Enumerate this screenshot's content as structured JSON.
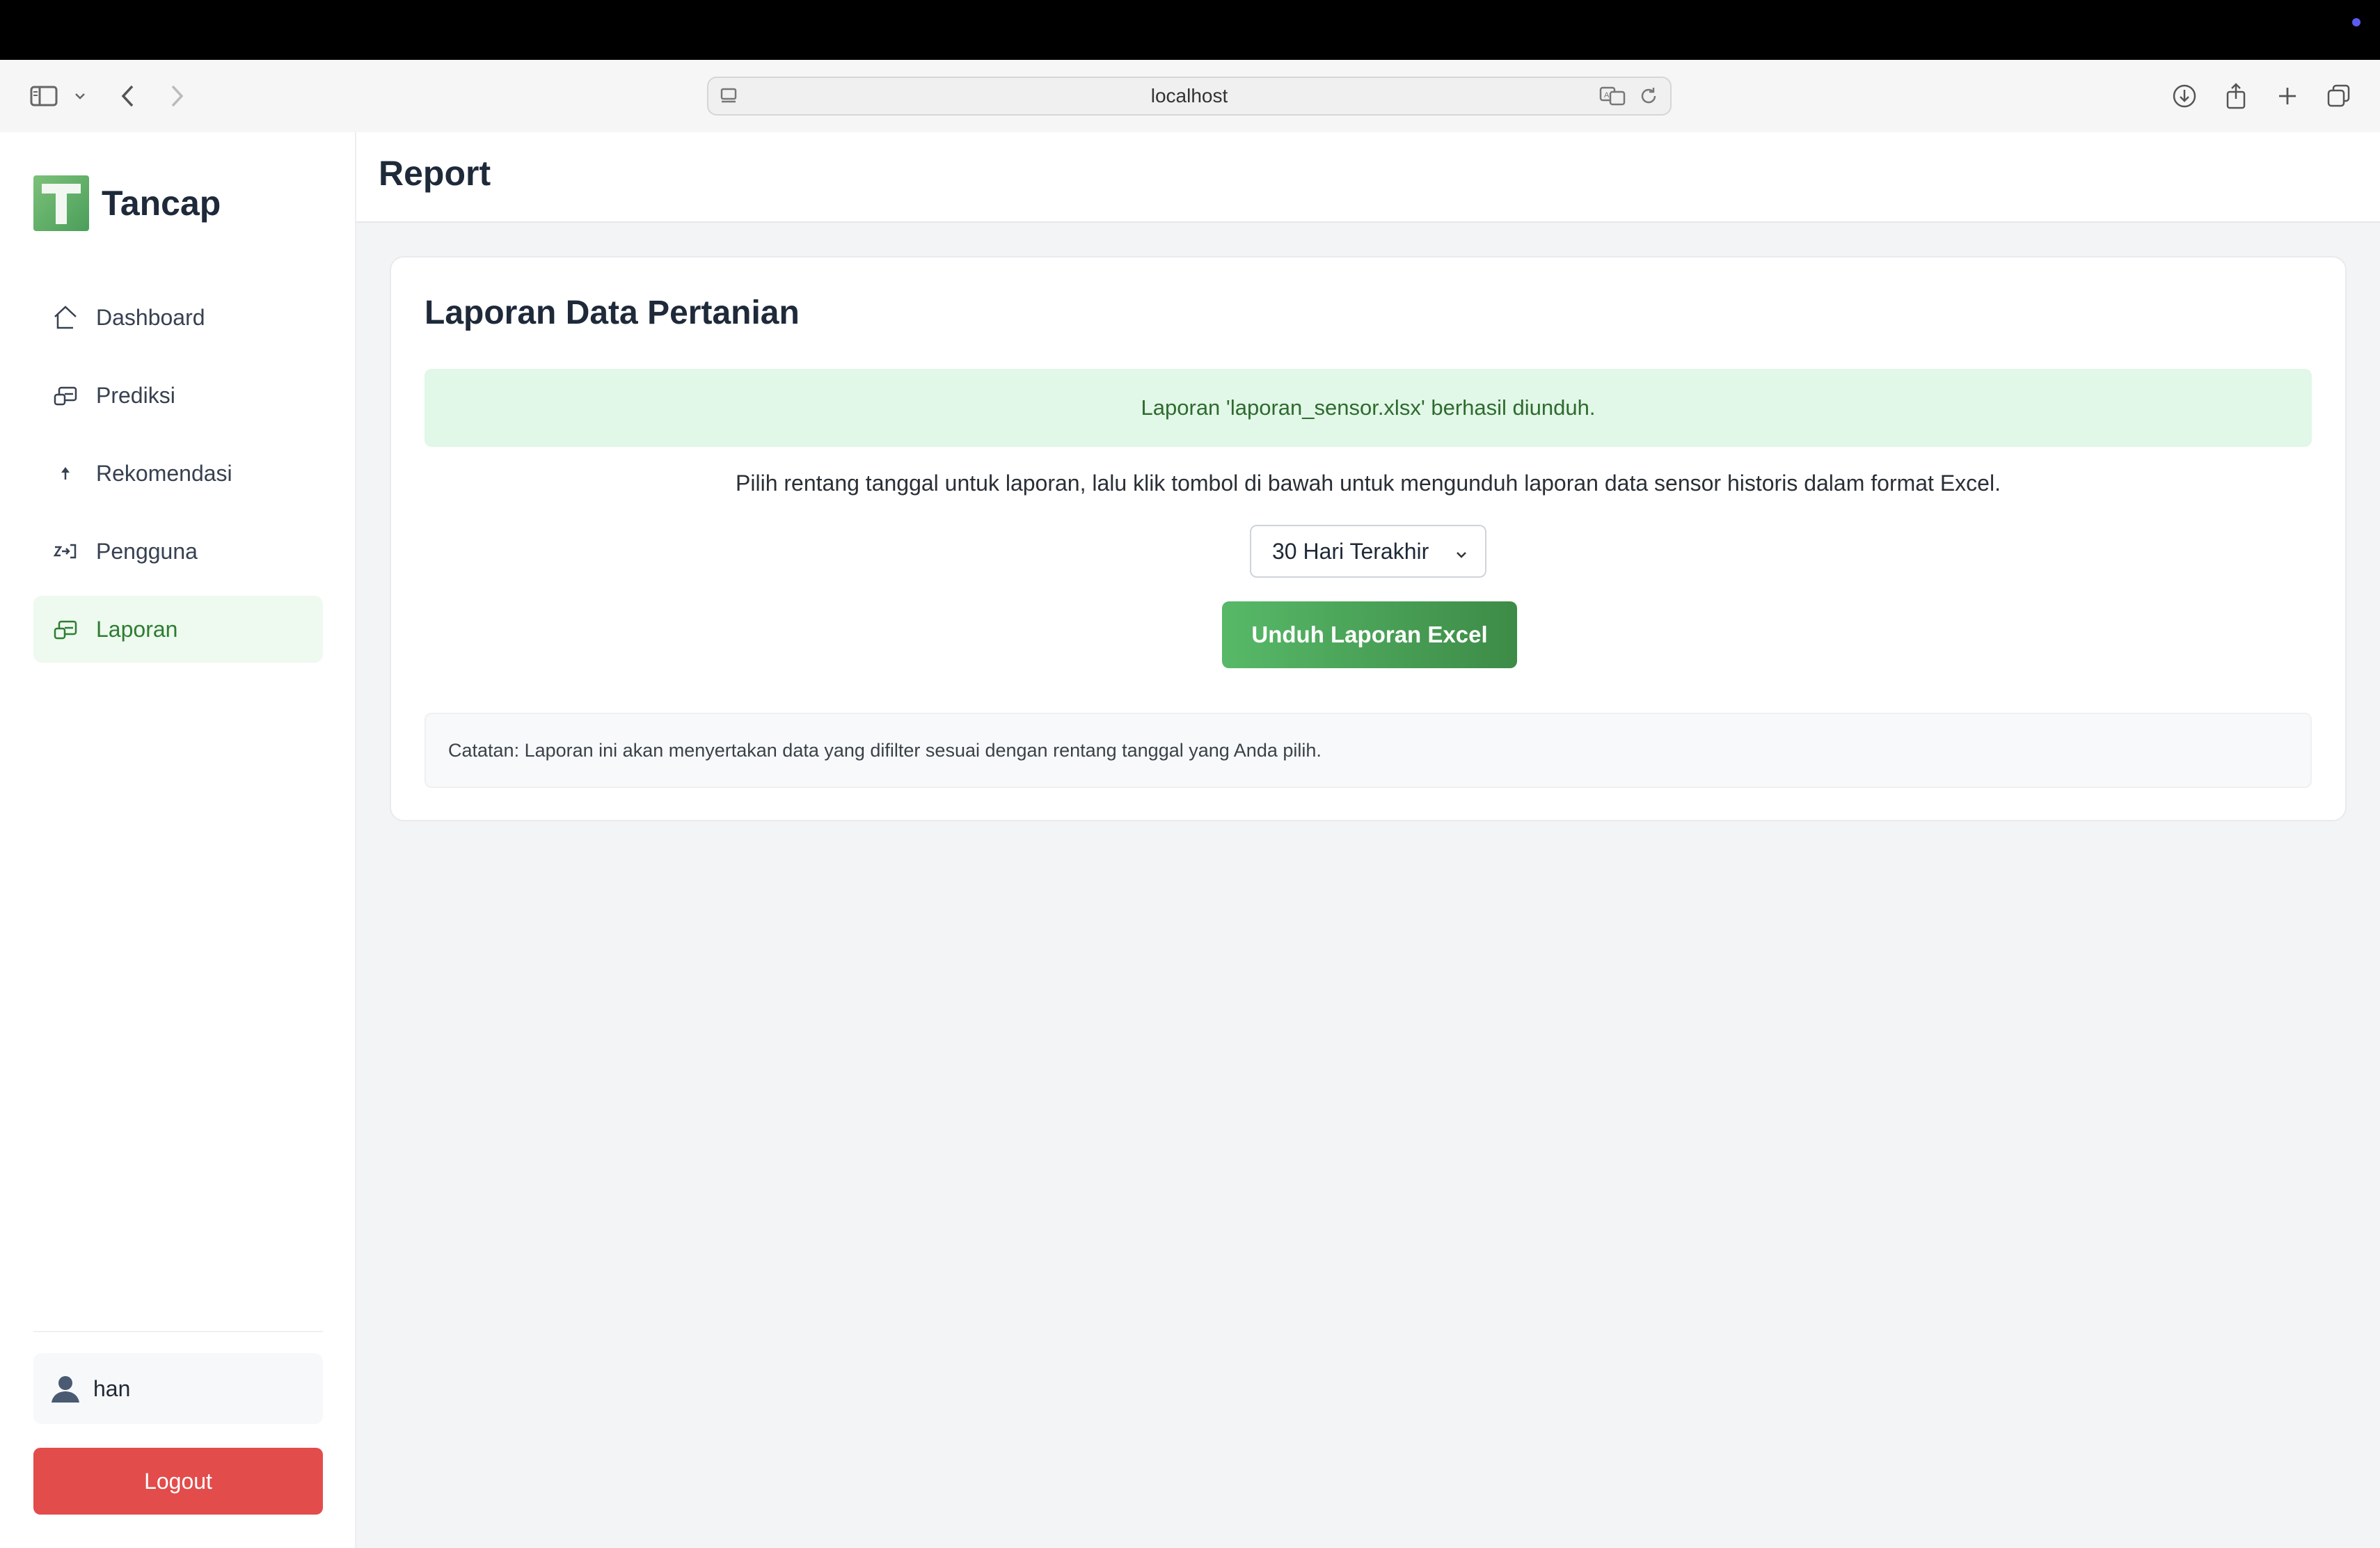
{
  "browser": {
    "address": "localhost"
  },
  "sidebar": {
    "brand": "Tancap",
    "items": [
      {
        "label": "Dashboard",
        "icon": "home-icon",
        "active": false
      },
      {
        "label": "Prediksi",
        "icon": "chart-icon",
        "active": false
      },
      {
        "label": "Rekomendasi",
        "icon": "pin-icon",
        "active": false
      },
      {
        "label": "Pengguna",
        "icon": "users-icon",
        "active": false
      },
      {
        "label": "Laporan",
        "icon": "report-icon",
        "active": true
      }
    ],
    "user": "han",
    "logout_label": "Logout"
  },
  "header": {
    "title": "Report"
  },
  "main": {
    "title": "Laporan Data Pertanian",
    "alert": "Laporan 'laporan_sensor.xlsx' berhasil diunduh.",
    "description": "Pilih rentang tanggal untuk laporan, lalu klik tombol di bawah untuk mengunduh laporan data sensor historis dalam format Excel.",
    "range_select": "30 Hari Terakhir",
    "download_label": "Unduh Laporan Excel",
    "note": "Catatan: Laporan ini akan menyertakan data yang difilter sesuai dengan rentang tanggal yang Anda pilih."
  },
  "colors": {
    "accent": "#4caf50",
    "logout": "#e24c4b",
    "alert_bg": "#e1f7e7",
    "alert_text": "#2e6b2f"
  }
}
